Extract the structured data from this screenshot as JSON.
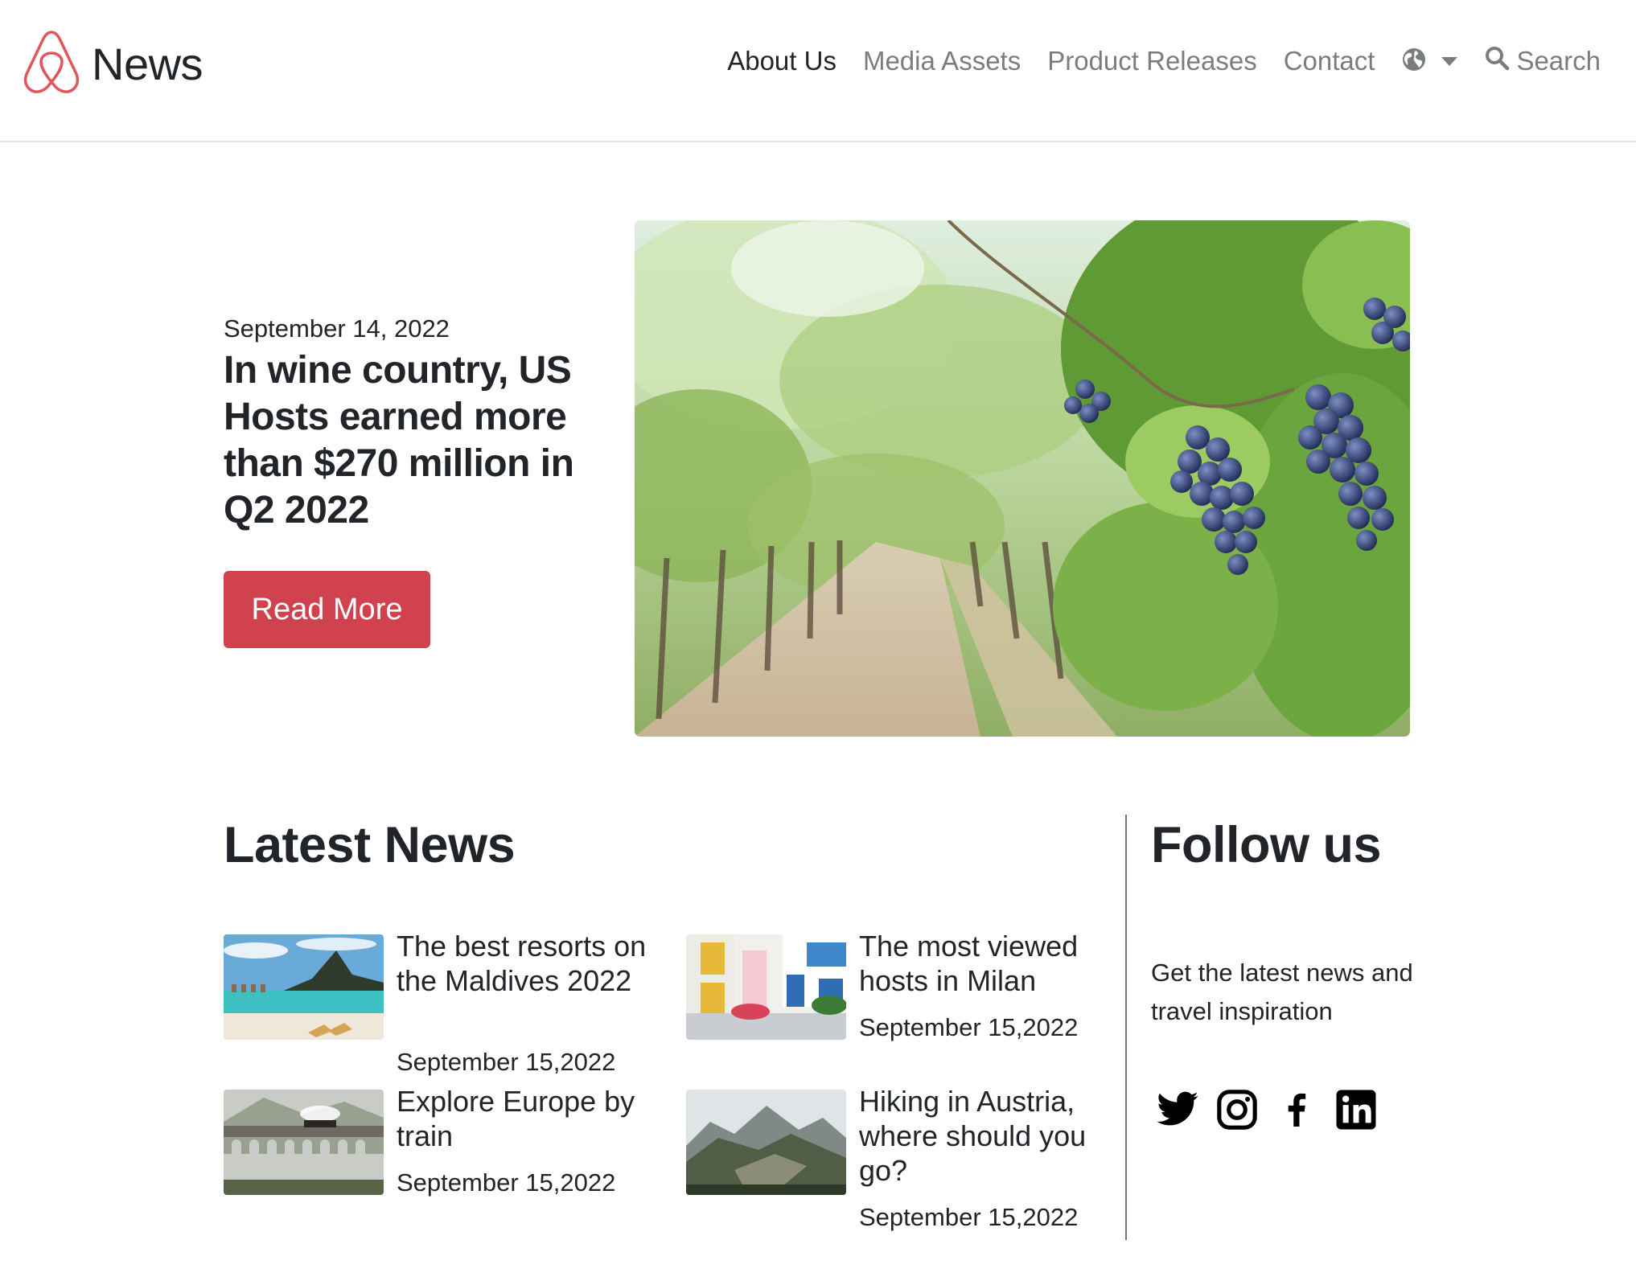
{
  "header": {
    "brand_title": "News",
    "brand_color": "#e0565b",
    "nav": {
      "about": "About Us",
      "media": "Media Assets",
      "releases": "Product Releases",
      "contact": "Contact"
    },
    "language_icon": "globe-icon",
    "search_label": "Search"
  },
  "hero": {
    "date": "September 14, 2022",
    "title": "In wine country, US Hosts earned more than $270 million in Q2 2022",
    "button_label": "Read More",
    "button_color": "#d0434e",
    "image_subject": "vineyard-grapes-image"
  },
  "latest": {
    "heading": "Latest News",
    "items": [
      {
        "title": "The best resorts on the Maldives 2022",
        "date": "September 15,2022",
        "image": "maldives-beach-image"
      },
      {
        "title": "The most viewed hosts in Milan",
        "date": "September 15,2022",
        "image": "colorful-street-image"
      },
      {
        "title": "Explore Europe by train",
        "date": "September 15,2022",
        "image": "viaduct-train-image"
      },
      {
        "title": "Hiking in Austria, where should you go?",
        "date": "September 15,2022",
        "image": "mountain-ruins-image"
      }
    ]
  },
  "follow": {
    "heading": "Follow us",
    "text": "Get the latest news and travel inspiration",
    "social": [
      "twitter-icon",
      "instagram-icon",
      "facebook-icon",
      "linkedin-icon"
    ]
  }
}
